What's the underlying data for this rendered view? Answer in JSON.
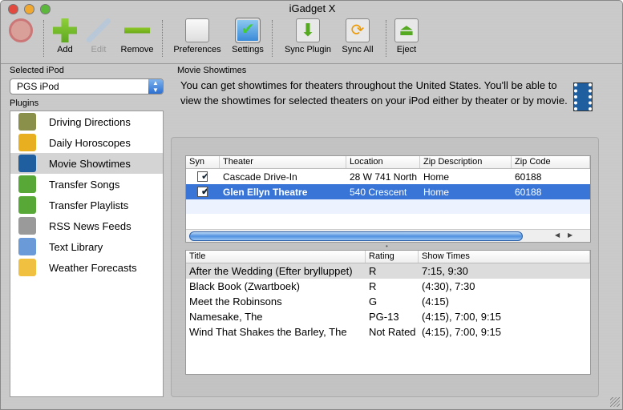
{
  "window": {
    "title": "iGadget X"
  },
  "toolbar": {
    "add": "Add",
    "edit": "Edit",
    "remove": "Remove",
    "preferences": "Preferences",
    "settings": "Settings",
    "sync_plugin": "Sync Plugin",
    "sync_all": "Sync All",
    "eject": "Eject"
  },
  "sidebar": {
    "selected_ipod_label": "Selected iPod",
    "selected_ipod": "PGS iPod",
    "plugins_label": "Plugins",
    "plugins": [
      {
        "label": "Driving Directions",
        "color": "#8a8f4a"
      },
      {
        "label": "Daily Horoscopes",
        "color": "#e8b020"
      },
      {
        "label": "Movie Showtimes",
        "color": "#1f5fa0"
      },
      {
        "label": "Transfer Songs",
        "color": "#58a838"
      },
      {
        "label": "Transfer Playlists",
        "color": "#58a838"
      },
      {
        "label": "RSS News Feeds",
        "color": "#9a9a9a"
      },
      {
        "label": "Text Library",
        "color": "#6a9ad8"
      },
      {
        "label": "Weather Forecasts",
        "color": "#f0c040"
      }
    ]
  },
  "main": {
    "section_label": "Movie Showtimes",
    "description": "You can get showtimes for theaters throughout the United States. You'll be able to view the showtimes for selected theaters on your iPod either by theater or by movie.",
    "theaters": {
      "columns": [
        "Syn",
        "Theater",
        "Location",
        "Zip Description",
        "Zip Code"
      ],
      "rows": [
        {
          "sync": true,
          "theater": "Cascade Drive-In",
          "location": "28 W 741 North",
          "zip_desc": "Home",
          "zip": "60188"
        },
        {
          "sync": true,
          "theater": "Glen Ellyn Theatre",
          "location": "540 Crescent",
          "zip_desc": "Home",
          "zip": "60188"
        }
      ]
    },
    "movies": {
      "columns": [
        "Title",
        "Rating",
        "Show Times"
      ],
      "rows": [
        {
          "title": "After the Wedding (Efter brylluppet)",
          "rating": "R",
          "times": "7:15, 9:30"
        },
        {
          "title": "Black Book (Zwartboek)",
          "rating": "R",
          "times": "(4:30), 7:30"
        },
        {
          "title": "Meet the Robinsons",
          "rating": "G",
          "times": "(4:15)"
        },
        {
          "title": "Namesake, The",
          "rating": "PG-13",
          "times": "(4:15), 7:00, 9:15"
        },
        {
          "title": "Wind That Shakes the Barley, The",
          "rating": "Not Rated",
          "times": "(4:15), 7:00, 9:15"
        }
      ]
    }
  }
}
